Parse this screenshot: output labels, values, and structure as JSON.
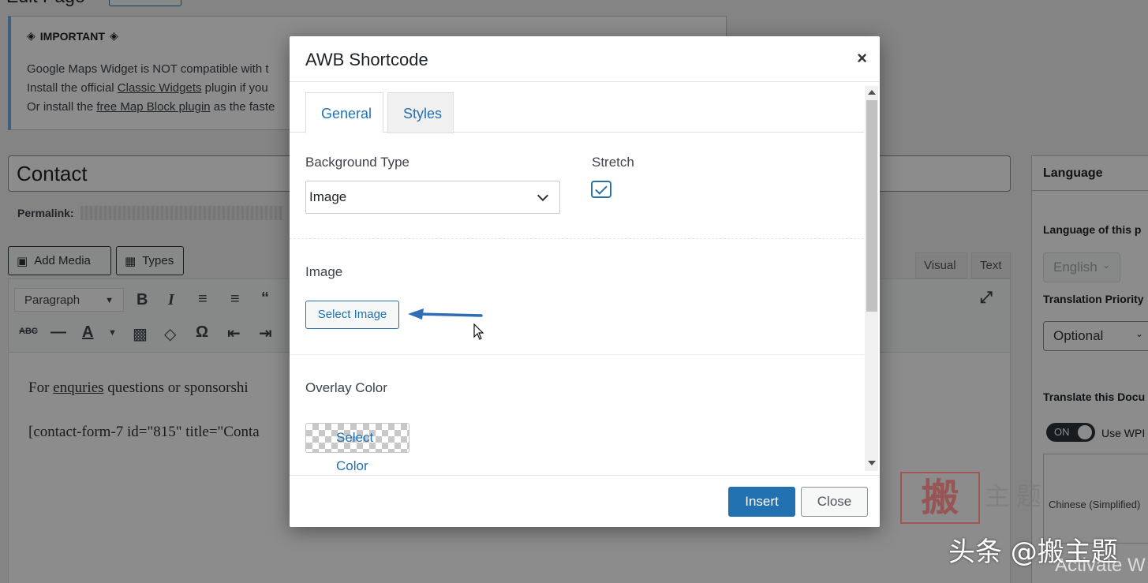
{
  "background": {
    "page_title": "Edit Page",
    "notice": {
      "heading": "IMPORTANT",
      "line1": "Google Maps Widget is NOT compatible with t",
      "line2_pre": "Install the official ",
      "line2_link": "Classic Widgets",
      "line2_post": " plugin if you",
      "line3_pre": "Or install the ",
      "line3_link": "free Map Block plugin",
      "line3_post": " as the faste"
    },
    "post_title": "Contact",
    "permalink_label": "Permalink:",
    "add_media_label": "Add Media",
    "types_label": "Types",
    "tab_visual": "Visual",
    "tab_text": "Text",
    "format_select": "Paragraph",
    "content_line1_pre": "For ",
    "content_line1_link": "enquries",
    "content_line1_post": " questions or sponsorshi",
    "content_line2": "[contact-form-7 id=\"815\" title=\"Conta",
    "sidebar": {
      "title": "Language",
      "language_label": "Language of this p",
      "language_value": "English",
      "priority_label": "Translation Priority",
      "priority_value": "Optional",
      "translate_label": "Translate this Docu",
      "toggle_label": "ON",
      "toggle_text": "Use WPI",
      "list_item": "Chinese (Simplified)"
    }
  },
  "modal": {
    "title": "AWB Shortcode",
    "close_symbol": "×",
    "tabs": [
      {
        "label": "General"
      },
      {
        "label": "Styles"
      }
    ],
    "fields": {
      "background_type_label": "Background Type",
      "background_type_value": "Image",
      "stretch_label": "Stretch",
      "stretch_checked": true,
      "image_label": "Image",
      "select_image_label": "Select Image",
      "overlay_color_label": "Overlay Color",
      "select_color_label": "Select Color"
    },
    "footer": {
      "insert_label": "Insert",
      "close_label": "Close"
    },
    "accent_color": "#2271b1"
  },
  "watermark": {
    "seal_char": "搬",
    "side_chars": "主题",
    "text": "头条 @搬主题",
    "activate_text": "Activate W"
  }
}
